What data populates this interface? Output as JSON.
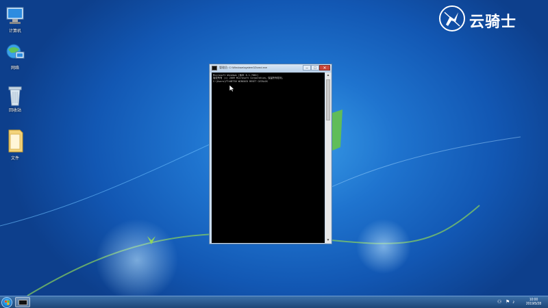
{
  "desktop": {
    "icons": [
      {
        "label": "计算机",
        "icon": "computer-icon"
      },
      {
        "label": "网络",
        "icon": "network-icon"
      },
      {
        "label": "回收站",
        "icon": "recycle-bin-icon"
      },
      {
        "label": "文件",
        "icon": "folder-icon"
      }
    ]
  },
  "logo": {
    "text": "云骑士"
  },
  "cmd_window": {
    "title": "管理员: C:\\Windows\\system32\\cmd.exe",
    "lines": [
      "Microsoft Windows [版本 6.1.7601]",
      "版权所有 (c) 2009 Microsoft Corporation。保留所有权利。",
      "",
      "C:\\Users\\FT>NETSH WINSOCK RESET CATALOG"
    ],
    "buttons": {
      "minimize": "–",
      "maximize": "□",
      "close": "✕"
    }
  },
  "taskbar": {
    "clock_time": "10:00",
    "clock_date": "2019/5/28"
  },
  "colors": {
    "desktop_blue": "#1f74cf",
    "taskbar": "#1d4677",
    "close_button": "#c9473c"
  }
}
